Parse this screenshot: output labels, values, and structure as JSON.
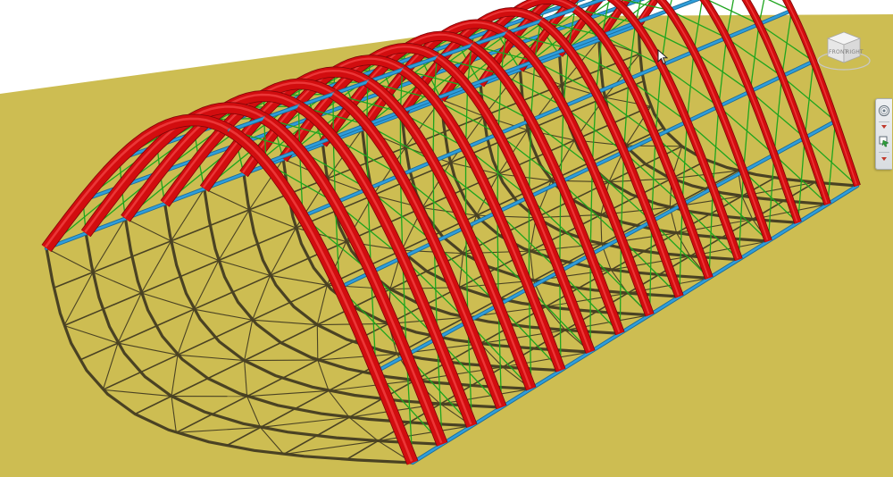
{
  "viewport": {
    "background_color": "#ffffff",
    "ground_color": "#cdbd52",
    "shadow_color": "#4a4223"
  },
  "structure": {
    "arch_color": "#d20d0f",
    "arch_highlight_color": "#ff5a5a",
    "purlin_color": "#2f9edb",
    "brace_color": "#1ea51e"
  },
  "view_cube": {
    "face_front": "FRONT",
    "face_right": "RIGHT"
  },
  "nav_bar": {
    "icons": [
      "steering-wheel-icon",
      "zoom-icon"
    ]
  }
}
